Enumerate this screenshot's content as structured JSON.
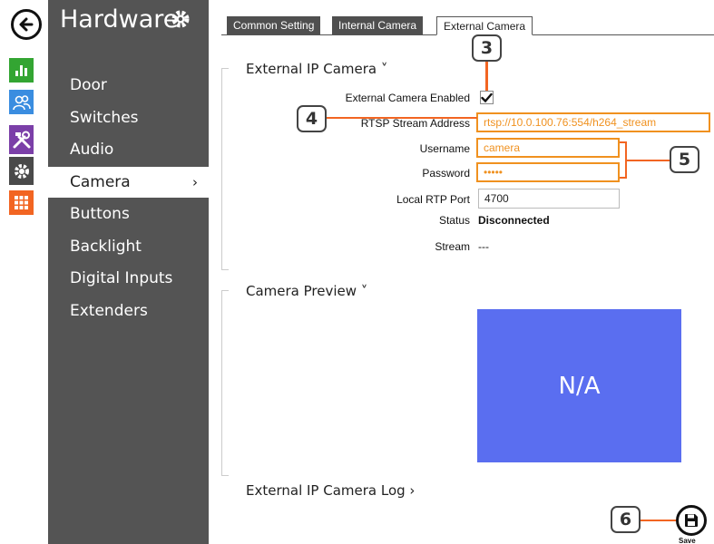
{
  "nav": {
    "back_label": "Back",
    "rail": [
      {
        "icon": "bar-chart-icon",
        "color": "#33a532"
      },
      {
        "icon": "users-icon",
        "color": "#3a8de0"
      },
      {
        "icon": "tools-icon",
        "color": "#7b3fa8"
      },
      {
        "icon": "gear-icon",
        "color": "#4a4a4a"
      },
      {
        "icon": "grid-icon",
        "color": "#f26522"
      }
    ]
  },
  "sidebar": {
    "title": "Hardware",
    "items": [
      {
        "label": "Door"
      },
      {
        "label": "Switches"
      },
      {
        "label": "Audio"
      },
      {
        "label": "Camera",
        "active": true
      },
      {
        "label": "Buttons"
      },
      {
        "label": "Backlight"
      },
      {
        "label": "Digital Inputs"
      },
      {
        "label": "Extenders"
      }
    ],
    "active_chevron": "›"
  },
  "tabs": [
    {
      "label": "Common Setting"
    },
    {
      "label": "Internal Camera"
    },
    {
      "label": "External Camera",
      "active": true
    }
  ],
  "sections": {
    "external_ip_camera": "External IP Camera ˅",
    "camera_preview": "Camera Preview ˅",
    "log": "External IP Camera Log ›"
  },
  "form": {
    "enabled_label": "External Camera Enabled",
    "enabled_checked": true,
    "rtsp_label": "RTSP Stream Address",
    "rtsp_value": "rtsp://10.0.100.76:554/h264_stream",
    "username_label": "Username",
    "username_value": "camera",
    "password_label": "Password",
    "password_value": "•••••",
    "rtp_port_label": "Local RTP Port",
    "rtp_port_value": "4700",
    "status_label": "Status",
    "status_value": "Disconnected",
    "stream_label": "Stream",
    "stream_value": "---"
  },
  "preview": {
    "text": "N/A",
    "color": "#5a6ef0"
  },
  "callouts": {
    "c3": "3",
    "c4": "4",
    "c5": "5",
    "c6": "6"
  },
  "save_label": "Save",
  "accent": "#f26522"
}
